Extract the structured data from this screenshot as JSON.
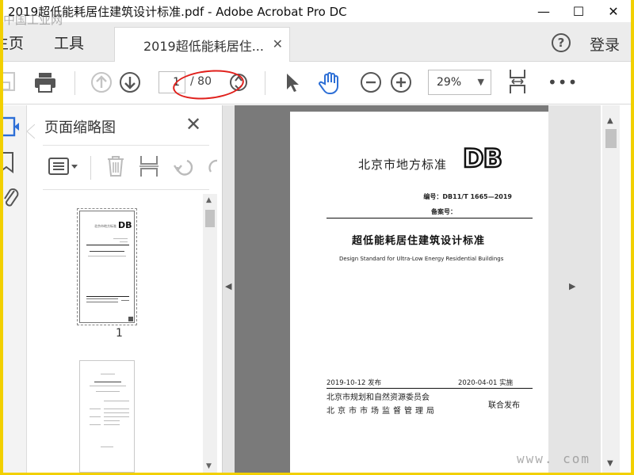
{
  "window": {
    "title": "2019超低能耗居住建筑设计标准.pdf - Adobe Acrobat Pro DC",
    "minimize": "—",
    "maximize": "☐",
    "close": "✕"
  },
  "tabs": {
    "home": "主页",
    "tools": "工具",
    "document_tab": "2019超低能耗居住...",
    "document_tab_close": "✕",
    "help": "?",
    "login": "登录"
  },
  "toolbar": {
    "page_current": "1",
    "page_total": "/ 80",
    "zoom": "29%",
    "zoom_caret": "▼",
    "more": "•••",
    "icons": [
      "save-icon",
      "print-icon",
      "page-up-icon",
      "page-down-icon",
      "rotate-icon",
      "select-cursor-icon",
      "hand-tool-icon",
      "zoom-out-icon",
      "zoom-in-icon",
      "zoom-caret-icon",
      "page-fit-icon",
      "more-icon"
    ],
    "annotation_color": "#e0201c"
  },
  "thumbnails_panel": {
    "title": "页面缩略图",
    "close": "✕",
    "page_label": "1",
    "icons": [
      "options-menu-icon",
      "delete-icon",
      "extract-icon",
      "undo-icon"
    ]
  },
  "left_rail": {
    "icons": [
      "page-thumbnails-icon",
      "bookmark-icon",
      "attachment-icon"
    ],
    "accent_color": "#2d6fd6"
  },
  "document": {
    "standard_label": "北京市地方标准",
    "logo": "DB",
    "code": "编号：DB11/T 1665—2019",
    "record": "备案号：",
    "title_cn": "超低能耗居住建筑设计标准",
    "title_en": "Design Standard for Ultra-Low Energy Residential Buildings",
    "publish_date": "2019-10-12 发布",
    "implement_date": "2020-04-01 实施",
    "issuer_1": "北京市规划和自然资源委员会",
    "issuer_2": "北京市市场监督管理局",
    "joint_issue": "联合发布"
  },
  "watermarks": {
    "top_left": "中国工业网",
    "bottom_right": "www.      com"
  }
}
